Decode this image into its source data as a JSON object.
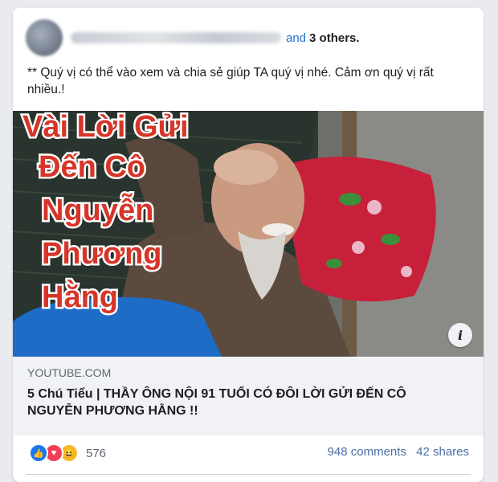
{
  "post": {
    "header": {
      "and_text": "and",
      "others_text": "3 others."
    },
    "text": "** Quý vị có thể vào xem và chia sẻ giúp TA quý vị nhé. Cảm ơn quý vị rất nhiều.!",
    "media": {
      "overlay_lines": [
        "Vài Lời Gửi",
        "Đến Cô",
        "Nguyễn",
        "Phương",
        "Hằng"
      ]
    },
    "link": {
      "domain": "YOUTUBE.COM",
      "title": "5 Chú Tiểu | THẦY ÔNG NỘI 91 TUỔI CÓ ĐÔI LỜI GỬI ĐẾN CÔ NGUYỄN PHƯƠNG HẰNG !!"
    },
    "footer": {
      "reaction_count": "576",
      "comments": "948 comments",
      "shares": "42 shares",
      "reaction_icons": [
        "like-icon",
        "love-icon",
        "haha-icon"
      ]
    }
  },
  "colors": {
    "accent": "#1877f2",
    "link_text": "#4b6ea5",
    "overlay_text": "#d63528"
  }
}
